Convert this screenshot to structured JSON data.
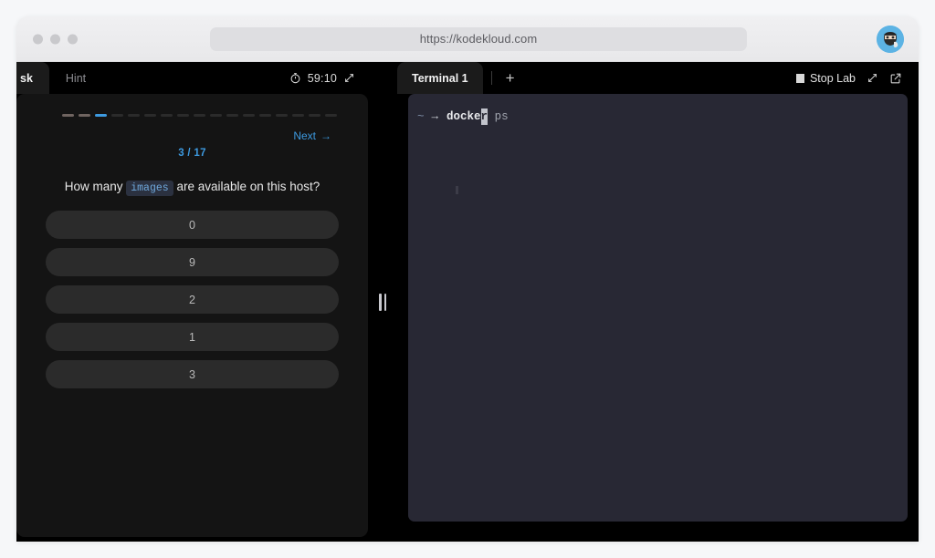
{
  "browser": {
    "url": "https://kodekloud.com",
    "traffic_lights": [
      "close",
      "minimize",
      "maximize"
    ],
    "avatar_name": "user-avatar",
    "avatar_bg": "#5cb3e4"
  },
  "left_panel": {
    "tabs": [
      {
        "label": "sk",
        "full_label": "Task",
        "active": true
      },
      {
        "label": "Hint",
        "active": false
      }
    ],
    "timer": {
      "icon": "stopwatch-icon",
      "value": "59:10"
    },
    "expand_icon": "expand-diagonal-icon",
    "progress": {
      "total": 17,
      "completed": 2,
      "current_index": 3,
      "done_color": "#6f6460",
      "current_color": "#3d9ae0",
      "pending_color": "#2b2b2b"
    },
    "next_label": "Next",
    "next_arrow": "→",
    "counter": "3 / 17",
    "question": {
      "prefix": "How many",
      "code": "images",
      "suffix": "are available on this host?"
    },
    "options": [
      {
        "label": "0"
      },
      {
        "label": "9"
      },
      {
        "label": "2"
      },
      {
        "label": "1"
      },
      {
        "label": "3"
      }
    ]
  },
  "divider": {
    "name": "panel-resize-handle"
  },
  "terminal_panel": {
    "tabs": [
      {
        "label": "Terminal 1",
        "active": true
      }
    ],
    "add_tab_label": "+",
    "stop_lab_label": "Stop Lab",
    "stop_icon": "stop-square-icon",
    "expand_icon": "expand-diagonal-icon",
    "popout_icon": "external-link-icon",
    "lines": [
      {
        "tilde": "~",
        "arrow": "→",
        "command_before_cursor": "docke",
        "cursor_char": "r",
        "arg": " ps"
      }
    ],
    "background": "#282834"
  }
}
